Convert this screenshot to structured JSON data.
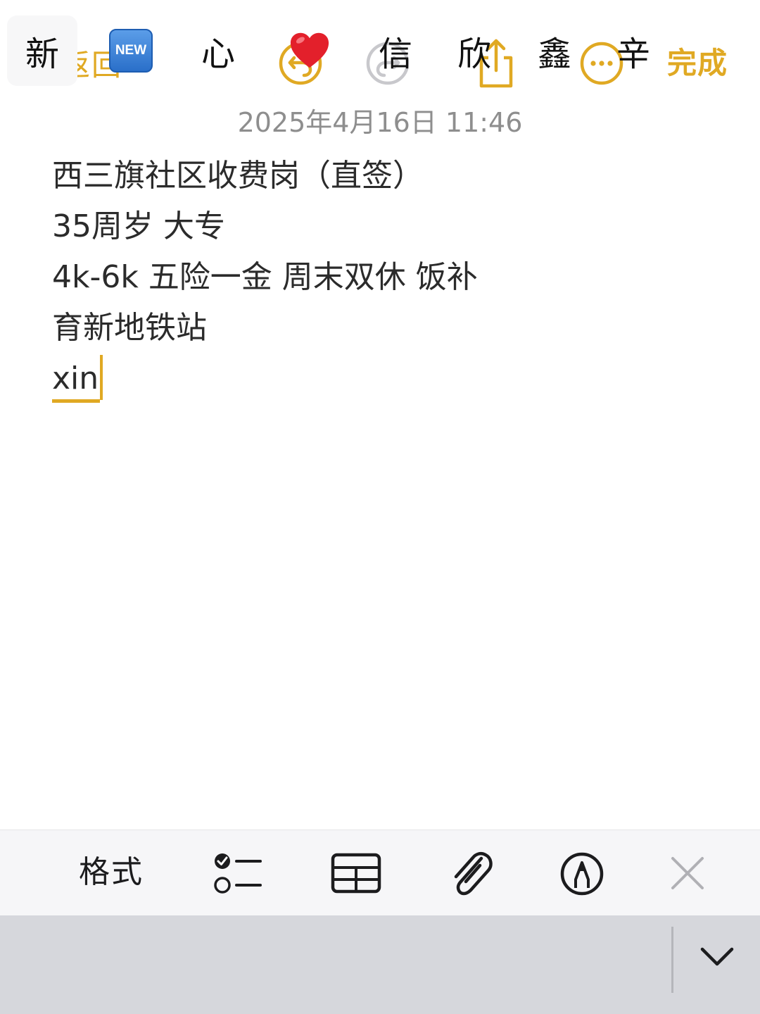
{
  "nav": {
    "back_label": "返回",
    "done_label": "完成",
    "accent_color": "#e0a923",
    "disabled_color": "#c8c8cc",
    "icons": [
      "chevron-left-icon",
      "undo-icon",
      "redo-icon",
      "share-icon",
      "more-icon"
    ]
  },
  "timestamp": "2025年4月16日 11:46",
  "note": {
    "lines": [
      "西三旗社区收费岗（直签）",
      "35周岁 大专",
      "4k-6k 五险一金 周末双休 饭补",
      "育新地铁站"
    ],
    "composing_text": "xin"
  },
  "toolbar": {
    "format_label": "格式",
    "icons": [
      "checklist-icon",
      "table-icon",
      "paperclip-icon",
      "markup-pen-icon",
      "close-icon"
    ]
  },
  "candidates": {
    "items": [
      "新",
      "NEW",
      "心",
      "❤️",
      "信",
      "欣",
      "鑫",
      "辛"
    ],
    "selected_index": 0,
    "collapse_icon": "chevron-down-icon"
  }
}
